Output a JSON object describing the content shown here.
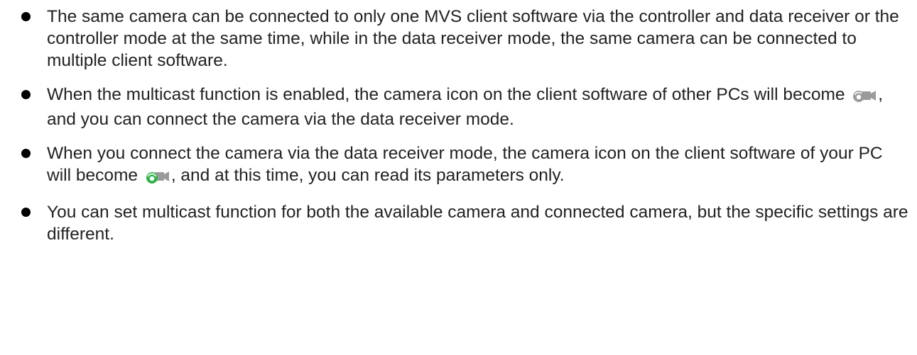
{
  "notes": [
    {
      "text": "The same camera can be connected to only one MVS client software via the controller and data receiver or the controller mode at the same time, while in the data receiver mode, the same camera can be connected to multiple client software."
    },
    {
      "before": "When the multicast function is enabled, the camera icon on the client software of other PCs will become ",
      "icon": "camera-multicast-gray-icon",
      "after": ", and you can connect the camera via the data receiver mode."
    },
    {
      "before": "When you connect the camera via the data receiver mode, the camera icon on the client software of your PC will become ",
      "icon": "camera-multicast-green-icon",
      "after": ", and at this time, you can read its parameters only."
    },
    {
      "text": "You can set multicast function for both the available camera and connected camera, but the specific settings are different."
    }
  ],
  "colors": {
    "text": "#222222",
    "bullet": "#000000",
    "icon_gray": "#9a9a9a",
    "icon_green": "#2fb34a"
  }
}
